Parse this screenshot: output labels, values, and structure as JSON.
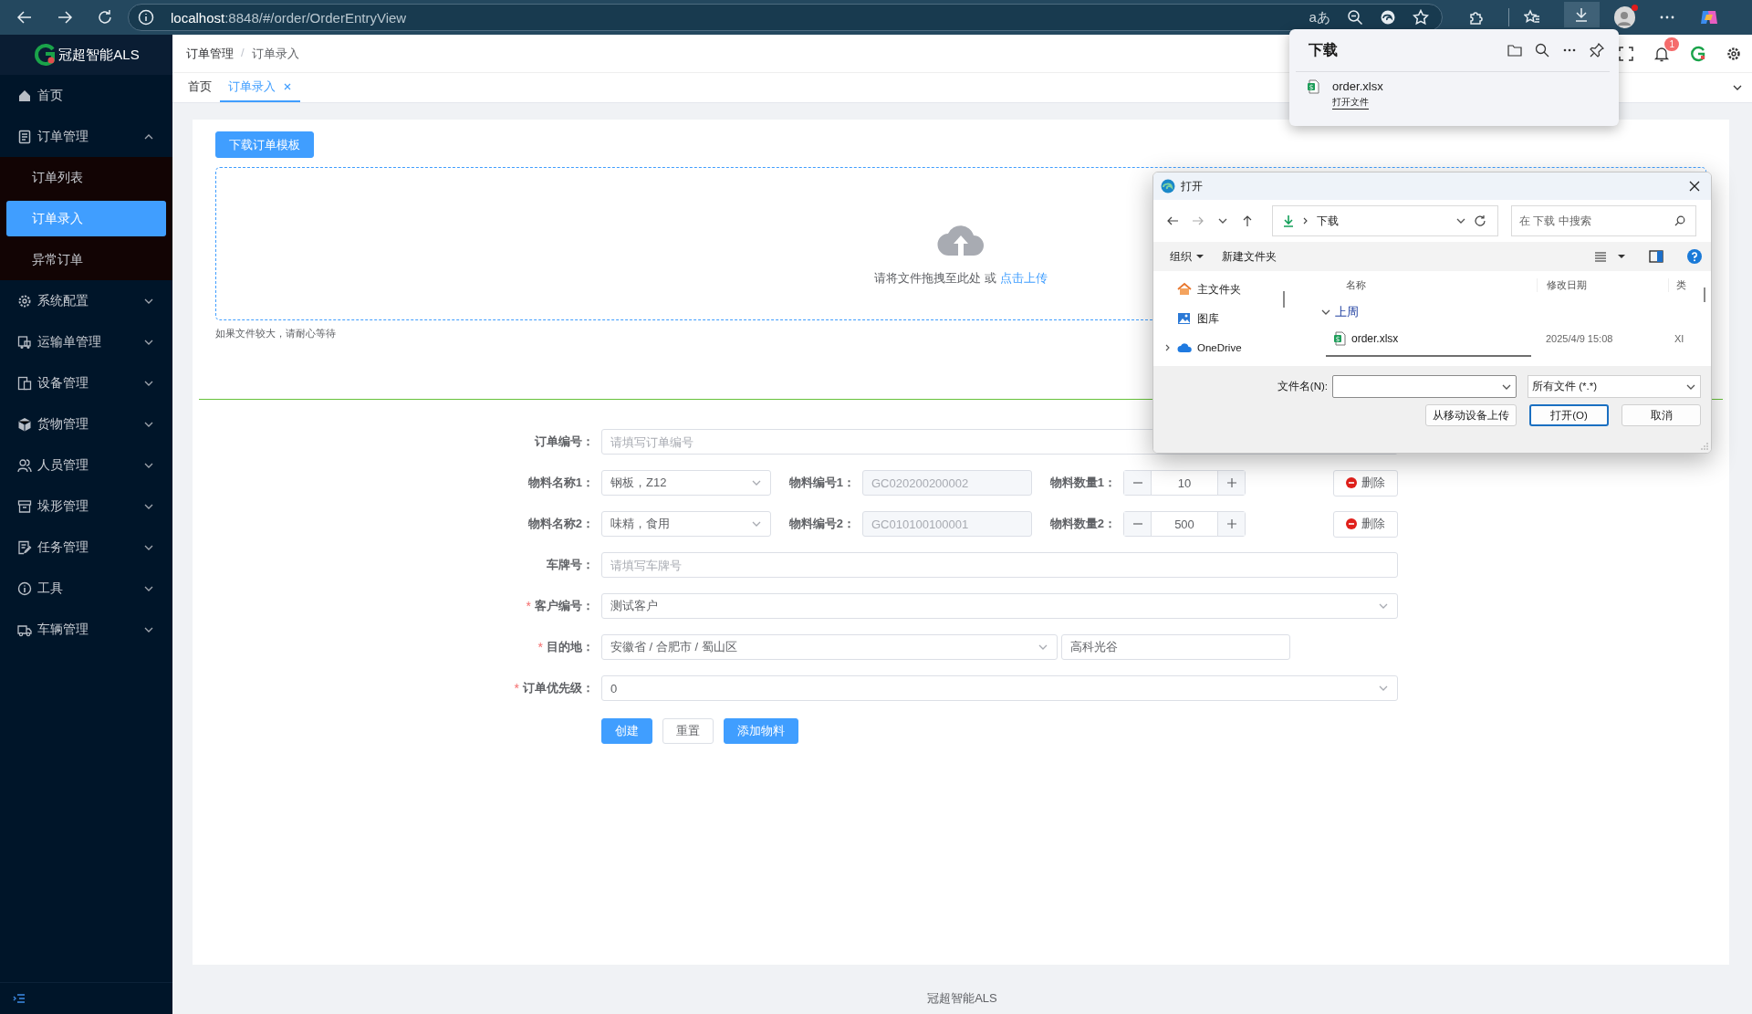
{
  "browser": {
    "url_host": "localhost",
    "url_path": ":8848/#/order/OrderEntryView",
    "read_aloud": "aあ"
  },
  "sidebar": {
    "logo": "冠超智能ALS",
    "items": [
      {
        "kind": "link",
        "label": "首页"
      },
      {
        "kind": "group",
        "label": "订单管理",
        "expanded": true,
        "children": [
          {
            "label": "订单列表",
            "selected": false
          },
          {
            "label": "订单录入",
            "selected": true
          },
          {
            "label": "异常订单",
            "selected": false
          }
        ]
      },
      {
        "kind": "group",
        "label": "系统配置",
        "expanded": false
      },
      {
        "kind": "group",
        "label": "运输单管理",
        "expanded": false
      },
      {
        "kind": "group",
        "label": "设备管理",
        "expanded": false
      },
      {
        "kind": "group",
        "label": "货物管理",
        "expanded": false
      },
      {
        "kind": "group",
        "label": "人员管理",
        "expanded": false
      },
      {
        "kind": "group",
        "label": "垛形管理",
        "expanded": false
      },
      {
        "kind": "group",
        "label": "任务管理",
        "expanded": false
      },
      {
        "kind": "group",
        "label": "工具",
        "expanded": false
      },
      {
        "kind": "group",
        "label": "车辆管理",
        "expanded": false
      }
    ]
  },
  "header": {
    "breadcrumb": [
      "订单管理",
      "订单录入"
    ],
    "breadcrumb_separator": "/",
    "notification_count": "1"
  },
  "tabs": [
    {
      "label": "首页",
      "selected": false,
      "closable": false
    },
    {
      "label": "订单录入",
      "selected": true,
      "closable": true
    }
  ],
  "page": {
    "template_button": "下载订单模板",
    "upload_text": "请将文件拖拽至此处 或 ",
    "upload_link": "点击上传",
    "tip": "如果文件较大，请耐心等待",
    "form": [
      {
        "kind": "text",
        "label": "订单编号：",
        "placeholder": "请填写订单编号"
      },
      {
        "kind": "material",
        "label": "物料名称1：",
        "value": "钢板，Z12",
        "code_label": "物料编号1：",
        "code": "GC020200200002",
        "qty_label": "物料数量1：",
        "qty": "10",
        "delete": "删除"
      },
      {
        "kind": "material",
        "label": "物料名称2：",
        "value": "味精，食用",
        "code_label": "物料编号2：",
        "code": "GC010100100001",
        "qty_label": "物料数量2：",
        "qty": "500",
        "delete": "删除"
      },
      {
        "kind": "text",
        "label": "车牌号：",
        "placeholder": "请填写车牌号"
      },
      {
        "kind": "select",
        "mark": "*",
        "label": "客户编号：",
        "value": "测试客户"
      },
      {
        "kind": "destination",
        "mark": "*",
        "label": "目的地：",
        "value": "安徽省 / 合肥市 / 蜀山区",
        "address": "高科光谷"
      },
      {
        "kind": "select",
        "mark": "*",
        "label": "订单优先级：",
        "value": "0"
      }
    ],
    "buttons": [
      {
        "label": "创建",
        "kind": "primary"
      },
      {
        "label": "重置",
        "kind": "default"
      },
      {
        "label": "添加物料",
        "kind": "primary"
      }
    ]
  },
  "footer": "冠超智能ALS",
  "downloads": {
    "title": "下载",
    "items": [
      {
        "name": "order.xlsx",
        "action": "打开文件"
      }
    ]
  },
  "file_dialog": {
    "title": "打开",
    "location": "下载",
    "search_placeholder": "在 下载 中搜索",
    "toolbar": [
      "组织",
      "新建文件夹"
    ],
    "nav": [
      {
        "label": "主文件夹",
        "expandable": false
      },
      {
        "label": "图库",
        "expandable": false
      },
      {
        "label": "OneDrive",
        "expandable": true
      }
    ],
    "columns": [
      "名称",
      "修改日期",
      "类"
    ],
    "groups": [
      {
        "label": "上周",
        "files": [
          {
            "name": "order.xlsx",
            "date": "2025/4/9 15:08",
            "type": "XI"
          }
        ]
      }
    ],
    "filename_label": "文件名(N):",
    "filter": "所有文件 (*.*)",
    "buttons": [
      {
        "label": "从移动设备上传",
        "kind": "default"
      },
      {
        "label": "打开(O)",
        "kind": "primary"
      },
      {
        "label": "取消",
        "kind": "default"
      }
    ]
  }
}
